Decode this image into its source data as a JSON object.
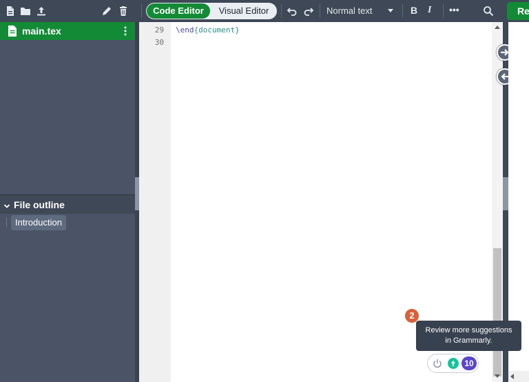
{
  "toolbar": {
    "code_editor_label": "Code Editor",
    "visual_editor_label": "Visual Editor",
    "style_select_value": "Normal text",
    "bold_label": "B",
    "italic_label": "I",
    "more_label": "•••",
    "recompile_label": "Re"
  },
  "sidebar": {
    "file_name": "main.tex",
    "outline_title": "File outline",
    "outline_items": [
      "Introduction"
    ]
  },
  "editor": {
    "line_numbers": [
      "29",
      "30"
    ],
    "lines": [
      {
        "command": "\\end",
        "arg": "{document}"
      }
    ]
  },
  "grammarly": {
    "badge_count": "2",
    "tooltip_line1": "Review more suggestions",
    "tooltip_line2": "in Grammarly.",
    "suggestion_count": "10"
  },
  "colors": {
    "accent_green": "#138a36",
    "toolbar_bg": "#3e4856",
    "sidebar_bg": "#4a5466",
    "grammarly_purple": "#5b45c9",
    "grammarly_green": "#15c39a",
    "badge_orange": "#d9603b"
  },
  "icons": [
    "new-file-icon",
    "new-folder-icon",
    "upload-icon",
    "rename-pencil-icon",
    "delete-trash-icon",
    "undo-icon",
    "redo-icon",
    "search-icon",
    "file-icon",
    "kebab-menu-icon",
    "chevron-down-icon",
    "arrow-right-icon",
    "arrow-left-icon",
    "power-icon",
    "grammarly-icon"
  ]
}
